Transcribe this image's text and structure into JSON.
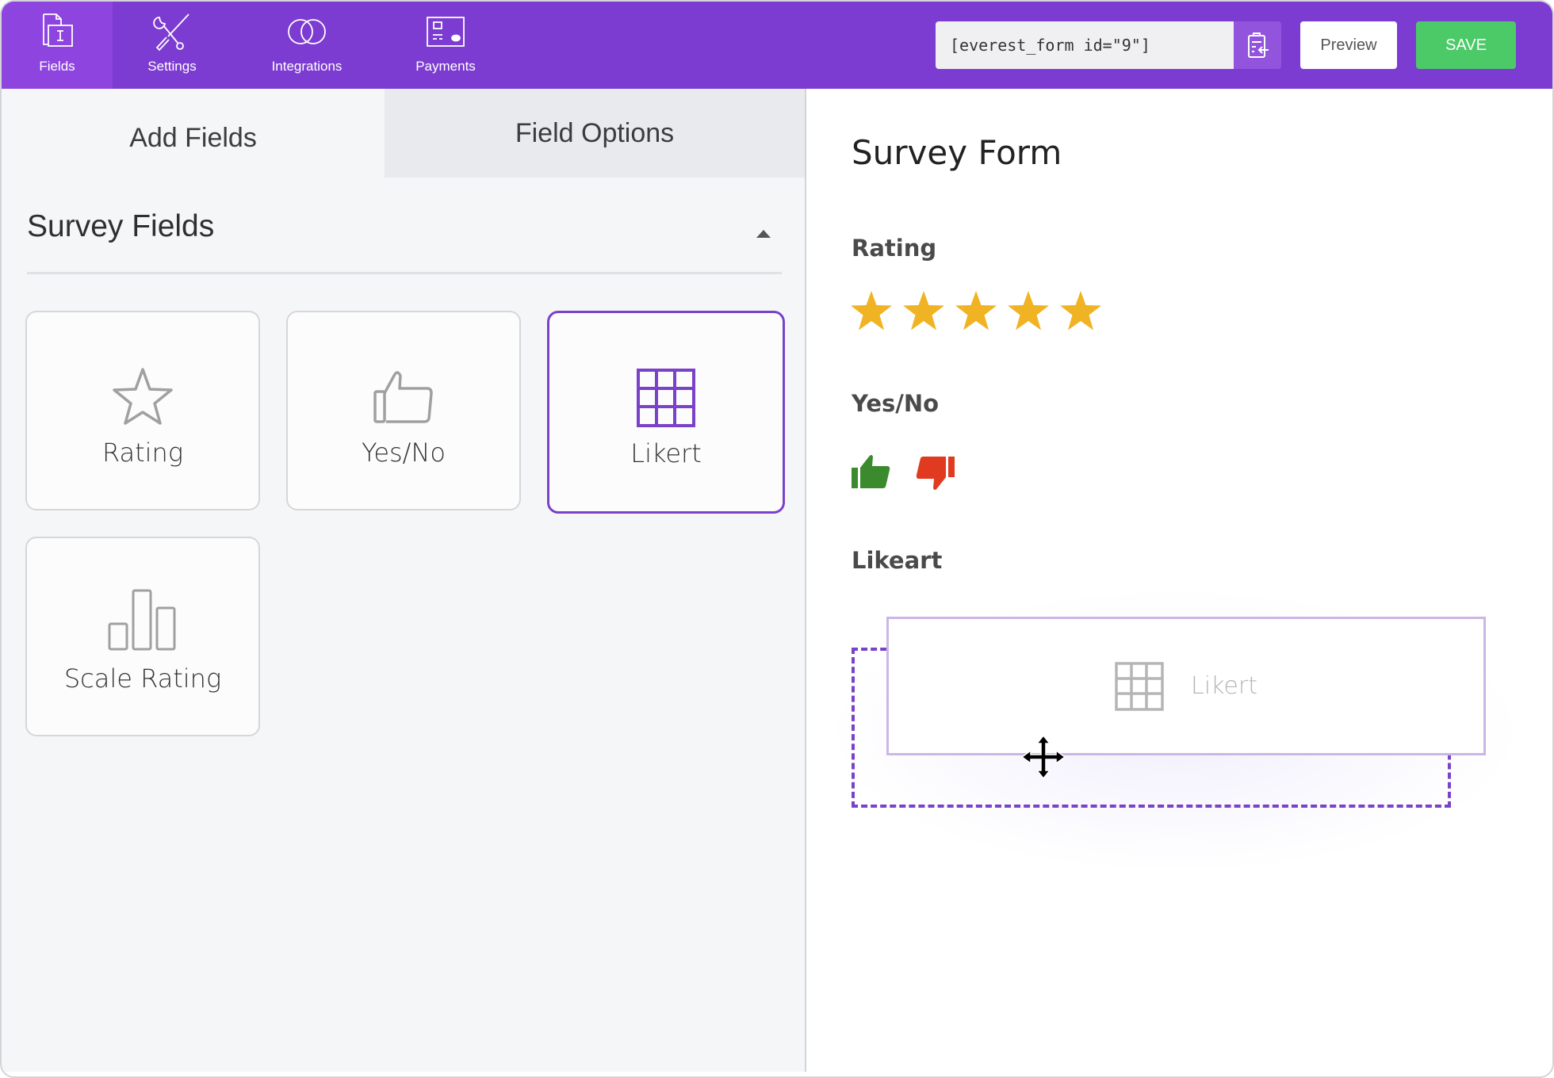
{
  "topbar": {
    "nav": [
      {
        "label": "Fields",
        "icon": "fields-icon",
        "active": true
      },
      {
        "label": "Settings",
        "icon": "settings-icon",
        "active": false
      },
      {
        "label": "Integrations",
        "icon": "integrations-icon",
        "active": false
      },
      {
        "label": "Payments",
        "icon": "payments-icon",
        "active": false
      }
    ],
    "shortcode": "[everest_form id=\"9\"]",
    "copy_icon": "clipboard-copy-icon",
    "preview_label": "Preview",
    "save_label": "SAVE",
    "colors": {
      "bar": "#7d3cd1",
      "active_tab": "#8e45e0",
      "save": "#4cca68"
    }
  },
  "left_panel": {
    "tabs": [
      {
        "label": "Add Fields",
        "active": true
      },
      {
        "label": "Field Options",
        "active": false
      }
    ],
    "section": {
      "title": "Survey Fields",
      "collapse_icon": "caret-up-icon",
      "fields": [
        {
          "label": "Rating",
          "icon": "star-outline-icon",
          "selected": false
        },
        {
          "label": "Yes/No",
          "icon": "thumbs-up-outline-icon",
          "selected": false
        },
        {
          "label": "Likert",
          "icon": "grid-icon",
          "selected": true
        },
        {
          "label": "Scale Rating",
          "icon": "bar-chart-icon",
          "selected": false
        }
      ]
    }
  },
  "form": {
    "title": "Survey Form",
    "fields": [
      {
        "label": "Rating",
        "type": "rating",
        "stars": 5,
        "star_color": "#f0b323"
      },
      {
        "label": "Yes/No",
        "type": "yes-no",
        "yes_color": "#3c8a2e",
        "no_color": "#e03a20"
      },
      {
        "label": "Likeart",
        "type": "likert-dropzone"
      }
    ],
    "drag_ghost": {
      "label": "Likert",
      "icon": "grid-icon"
    },
    "accent": "#7a42c8"
  }
}
